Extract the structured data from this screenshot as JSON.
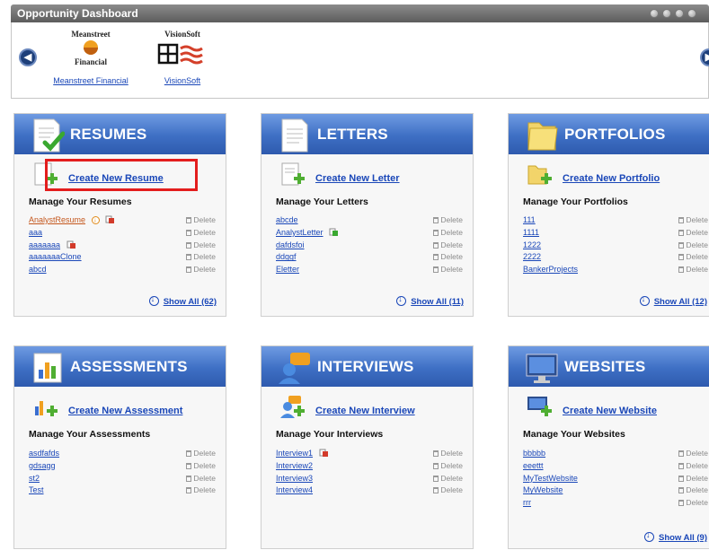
{
  "dashboard": {
    "title": "Opportunity Dashboard",
    "companies": [
      {
        "logo_line1": "Meanstreet",
        "logo_line2": "Financial",
        "link": "Meanstreet Financial"
      },
      {
        "logo_text": "VisionSoft",
        "link": "VisionSoft"
      }
    ]
  },
  "colors": {
    "header_blue": "#3e6fc4",
    "link_blue": "#1a47b8",
    "highlight_red": "#e31d1d",
    "active_orange": "#c4571d"
  },
  "delete_label": "Delete",
  "widgets": {
    "resumes": {
      "title": "RESUMES",
      "create": "Create New Resume",
      "manage": "Manage Your Resumes",
      "items": [
        "AnalystResume",
        "aaa",
        "aaaaaaa",
        "aaaaaaaClone",
        "abcd"
      ],
      "show_all": "Show All (62)"
    },
    "letters": {
      "title": "LETTERS",
      "create": "Create New Letter",
      "manage": "Manage Your Letters",
      "items": [
        "abcde",
        "AnalystLetter",
        "dafdsfoi",
        "ddggf",
        "Eletter"
      ],
      "show_all": "Show All (11)"
    },
    "portfolios": {
      "title": "PORTFOLIOS",
      "create": "Create New Portfolio",
      "manage": "Manage Your Portfolios",
      "items": [
        "111",
        "1111",
        "1222",
        "2222",
        "BankerProjects"
      ],
      "show_all": "Show All (12)"
    },
    "assessments": {
      "title": "ASSESSMENTS",
      "create": "Create New Assessment",
      "manage": "Manage Your Assessments",
      "items": [
        "asdfafds",
        "gdsagg",
        "st2",
        "Test"
      ]
    },
    "interviews": {
      "title": "INTERVIEWS",
      "create": "Create New Interview",
      "manage": "Manage Your Interviews",
      "items": [
        "Interview1",
        "Interview2",
        "Interview3",
        "Interview4"
      ]
    },
    "websites": {
      "title": "WEBSITES",
      "create": "Create New Website",
      "manage": "Manage Your Websites",
      "items": [
        "bbbbb",
        "eeettt",
        "MyTestWebsite",
        "MyWebsite",
        "rrr"
      ],
      "show_all": "Show All (9)"
    }
  }
}
